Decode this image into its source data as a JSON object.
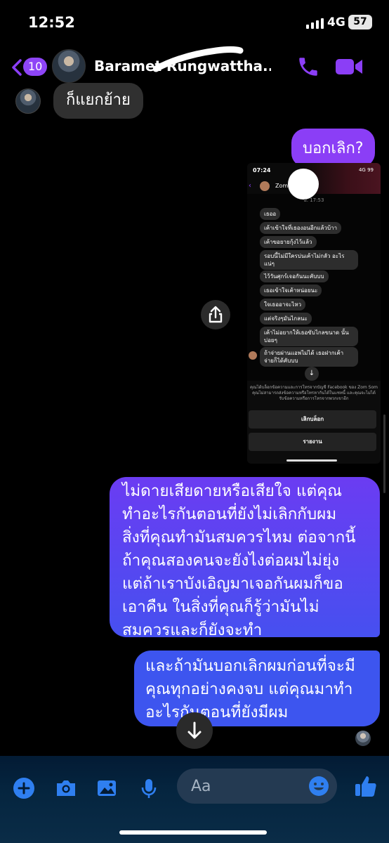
{
  "status_bar": {
    "time": "12:52",
    "network": "4G",
    "battery": "57"
  },
  "header": {
    "back_count": "10",
    "contact_name": "Baramet Rungwattha...",
    "icons": [
      "chevron-left-icon",
      "phone-icon",
      "video-camera-icon"
    ]
  },
  "accent_color": "#8b3ef6",
  "messages": [
    {
      "sender": "contact",
      "text": "ก็แยกย้าย"
    },
    {
      "sender": "me",
      "text": "บอกเลิก?"
    },
    {
      "sender": "me",
      "lines": [
        "ไม่ดายเสียดายหรือเสียใจ แต่คุณ",
        "ทำอะไรกันตอนที่ยังไม่เลิกกับผม",
        "สิ่งที่คุณทำมันสมควรไหม ต่อจากนี้",
        "ถ้าคุณสองคนจะยังไงต่อผมไม่ยุ่ง",
        "แต่ถ้าเราบังเอิญมาเจอกันผมก็ขอ",
        "เอาคืน ในสิ่งที่คุณก็รู้ว่ามันไม่",
        "สมควรและก็ยังจะทำ"
      ]
    },
    {
      "sender": "me",
      "lines": [
        "และถ้ามันบอกเลิกผมก่อนที่จะมี",
        "คุณทุกอย่างคงจบ แต่คุณมาทำ",
        "อะไรกันตอนที่ยังมีผม"
      ]
    }
  ],
  "shared_screenshot": {
    "time": "07:24",
    "signal": "4G",
    "battery": "99",
    "name": "Zom S",
    "date": "อ. 17:53",
    "messages": [
      "เธออ",
      "เค้าเข้าใจที่เธองอนอีกแล้วบ้าา",
      "เค้าขอยายกุ้งไว้แล้ว",
      "รอบนี้ไม่มีใครบ่นเค้าไม่กลัว อะไรแน่ๆ",
      "ไว้วันศุกร์เจอกันนะคับบบ",
      "เธอเข้าใจเค้าหน่อยนะ",
      "ใจเธออาจะไหว",
      "แต่จริงๆมันไกลนะ",
      "เค้าไม่อยากให้เธอขับไกลขนาด นั้นบ่อยๆ",
      "ถ้าจ่ายผ่านแอพไม่ได้ เธอฝากเค้า จ่ายก็ได้คับบบ"
    ],
    "notice": "คุณได้บล็อกข้อความและการโทรจากบัญชี Facebook ของ Zom Som คุณไม่สามารถส่งข้อความหรือโทรหากันได้ในแชทนี้ และคุณจะไม่ได้รับข้อความหรือการโทรจากพวกเขาอีก",
    "buttons": [
      "เลิกบล็อก",
      "รายงาน"
    ]
  },
  "composer": {
    "placeholder": "Aa",
    "icons": [
      "plus-icon",
      "camera-icon",
      "image-icon",
      "microphone-icon",
      "emoji-icon",
      "thumbs-up-icon"
    ]
  }
}
